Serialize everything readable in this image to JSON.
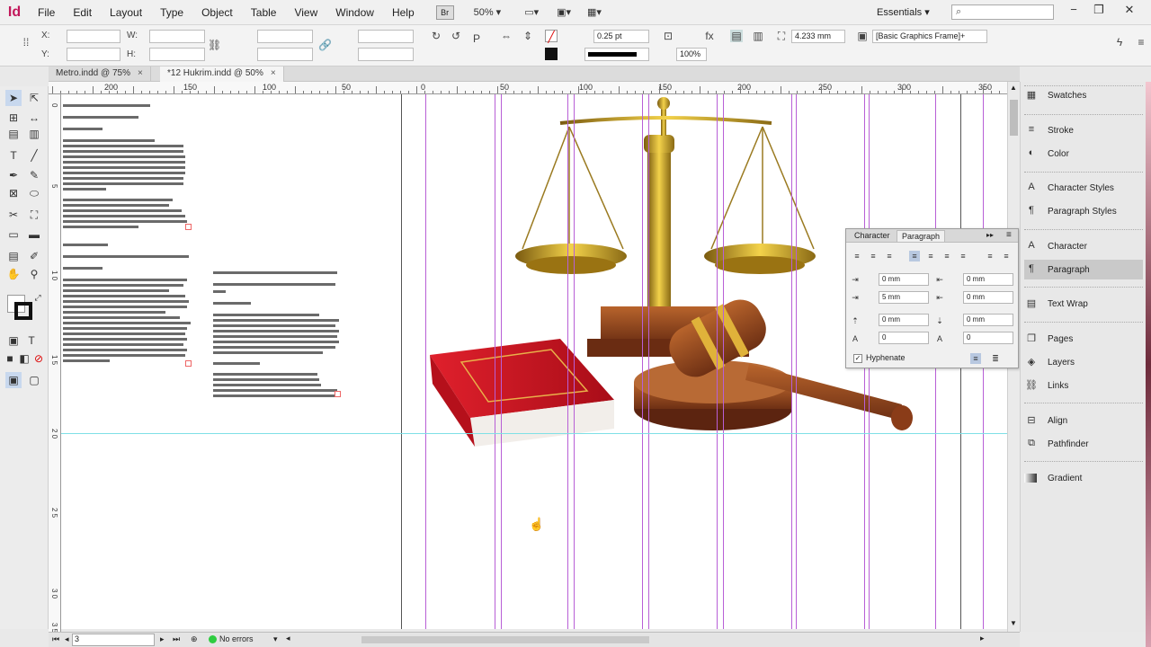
{
  "app": {
    "logo": "Id",
    "menu": [
      "File",
      "Edit",
      "Layout",
      "Type",
      "Object",
      "Table",
      "View",
      "Window",
      "Help"
    ],
    "bridge_label": "Br",
    "zoom": "50%",
    "workspace": "Essentials",
    "search_placeholder": "",
    "window_buttons": [
      "−",
      "❐",
      "✕"
    ]
  },
  "control_panel": {
    "x_label": "X:",
    "y_label": "Y:",
    "w_label": "W:",
    "h_label": "H:",
    "stroke_weight": "0.25 pt",
    "scale_percent": "100%",
    "offset_value": "4.233 mm",
    "object_style": "[Basic Graphics Frame]+"
  },
  "tabs": [
    {
      "label": "Metro.indd @ 75%",
      "close": "×"
    },
    {
      "label": "*12 Hukrim.indd @ 50%",
      "close": "×"
    }
  ],
  "ruler": {
    "labels": [
      "200",
      "150",
      "100",
      "50",
      "0",
      "50",
      "100",
      "150",
      "200",
      "250",
      "300",
      "350"
    ],
    "vertical": [
      "0",
      "5",
      "1 0",
      "1 5",
      "2 0",
      "2 5",
      "3 0",
      "3 5"
    ]
  },
  "paragraph_panel": {
    "tab_character": "Character",
    "tab_paragraph": "Paragraph",
    "left_indent": "0 mm",
    "right_indent": "0 mm",
    "first_line_indent": "5 mm",
    "last_line_indent": "0 mm",
    "space_before": "0 mm",
    "space_after": "0 mm",
    "drop_cap_lines": "0",
    "drop_cap_chars": "0",
    "hyphenate_label": "Hyphenate",
    "hyphenate_checked": true
  },
  "dock": {
    "items": [
      {
        "label": "Swatches",
        "icon": "swatches-icon"
      },
      {
        "label": "Stroke",
        "icon": "stroke-icon"
      },
      {
        "label": "Color",
        "icon": "color-icon"
      },
      {
        "label": "Character Styles",
        "icon": "character-styles-icon"
      },
      {
        "label": "Paragraph Styles",
        "icon": "paragraph-styles-icon"
      },
      {
        "label": "Character",
        "icon": "character-icon"
      },
      {
        "label": "Paragraph",
        "icon": "paragraph-icon"
      },
      {
        "label": "Text Wrap",
        "icon": "text-wrap-icon"
      },
      {
        "label": "Pages",
        "icon": "pages-icon"
      },
      {
        "label": "Layers",
        "icon": "layers-icon"
      },
      {
        "label": "Links",
        "icon": "links-icon"
      },
      {
        "label": "Align",
        "icon": "align-icon"
      },
      {
        "label": "Pathfinder",
        "icon": "pathfinder-icon"
      },
      {
        "label": "Gradient",
        "icon": "gradient-icon"
      }
    ],
    "active": "Paragraph"
  },
  "status_bar": {
    "page_number": "3",
    "preflight": "No errors"
  },
  "colors": {
    "brand": "#c2185b",
    "margin_guide": "#b85fd6",
    "bleed_guide": "#7fe0e6",
    "preflight_ok": "#2ecc40"
  }
}
